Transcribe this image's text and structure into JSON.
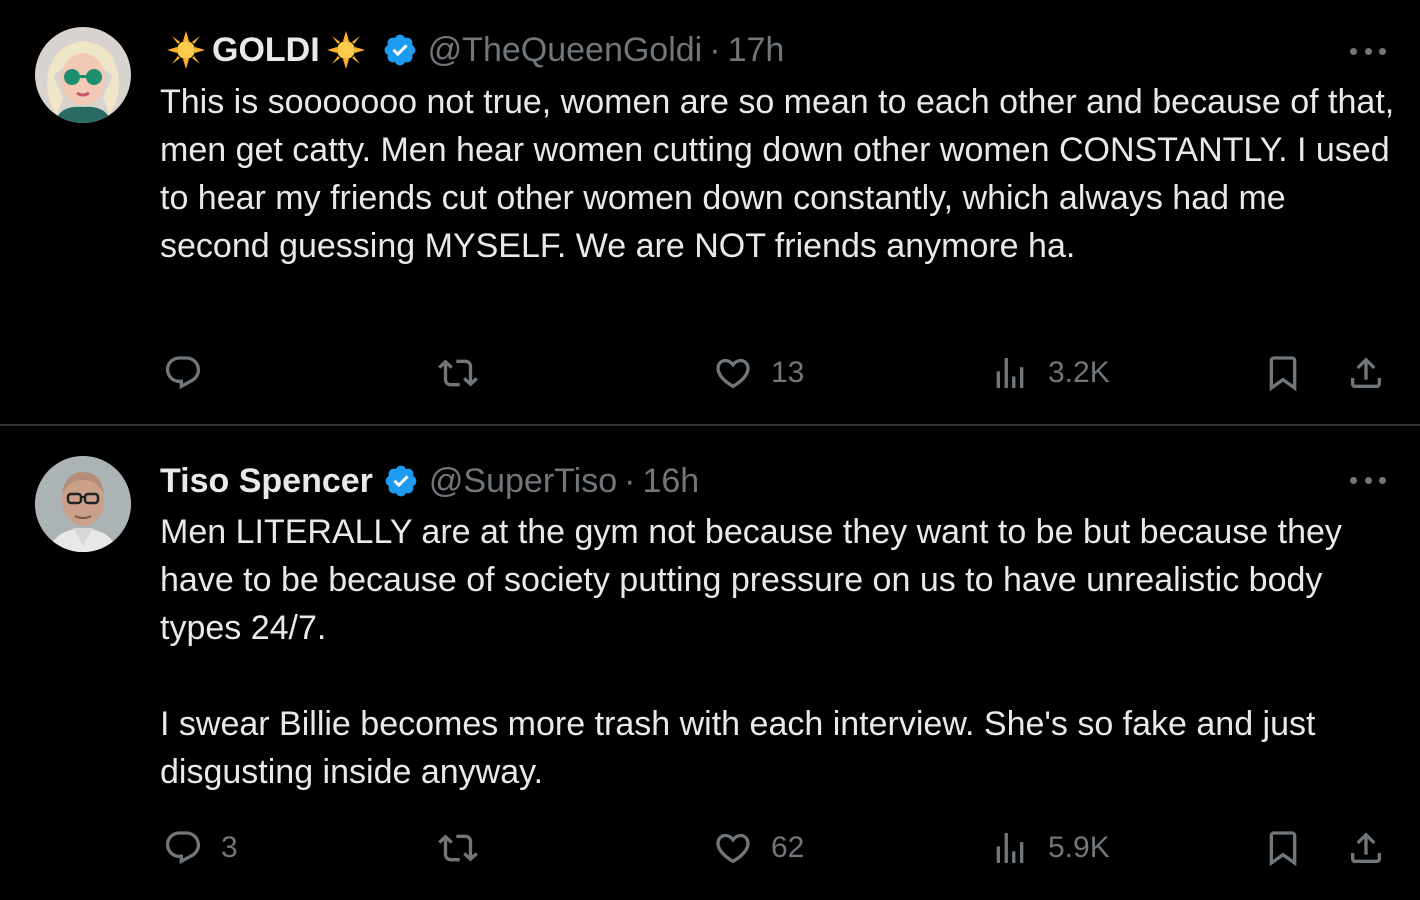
{
  "tweets": [
    {
      "display_name": "GOLDI",
      "name_decoration": "sun-emoji",
      "verified": true,
      "handle": "@TheQueenGoldi",
      "separator": "·",
      "time": "17h",
      "text_paragraphs": [
        "This is sooooooo not true, women are so mean to each other and because of that, men get catty. Men hear women cutting down other women CONSTANTLY. I used to hear my friends cut other women down constantly, which always had me second guessing MYSELF. We are NOT friends anymore ha."
      ],
      "replies": "",
      "retweets": "",
      "likes": "13",
      "views": "3.2K"
    },
    {
      "display_name": "Tiso Spencer",
      "verified": true,
      "handle": "@SuperTiso",
      "separator": "·",
      "time": "16h",
      "text_paragraphs": [
        "Men LITERALLY are at the gym not because they want to be but because they have to be because of society putting pressure on us to have unrealistic body types 24/7.",
        "I swear Billie becomes more trash with each interview. She's so fake and just disgusting inside anyway."
      ],
      "replies": "3",
      "retweets": "",
      "likes": "62",
      "views": "5.9K"
    }
  ],
  "colors": {
    "background": "#000000",
    "text": "#e7e9ea",
    "secondary": "#71767b",
    "verified": "#1d9bf0",
    "divider": "#2f3336"
  },
  "icons": [
    "reply-icon",
    "retweet-icon",
    "like-icon",
    "views-icon",
    "bookmark-icon",
    "share-icon",
    "more-icon",
    "verified-icon",
    "sun-emoji-icon"
  ]
}
